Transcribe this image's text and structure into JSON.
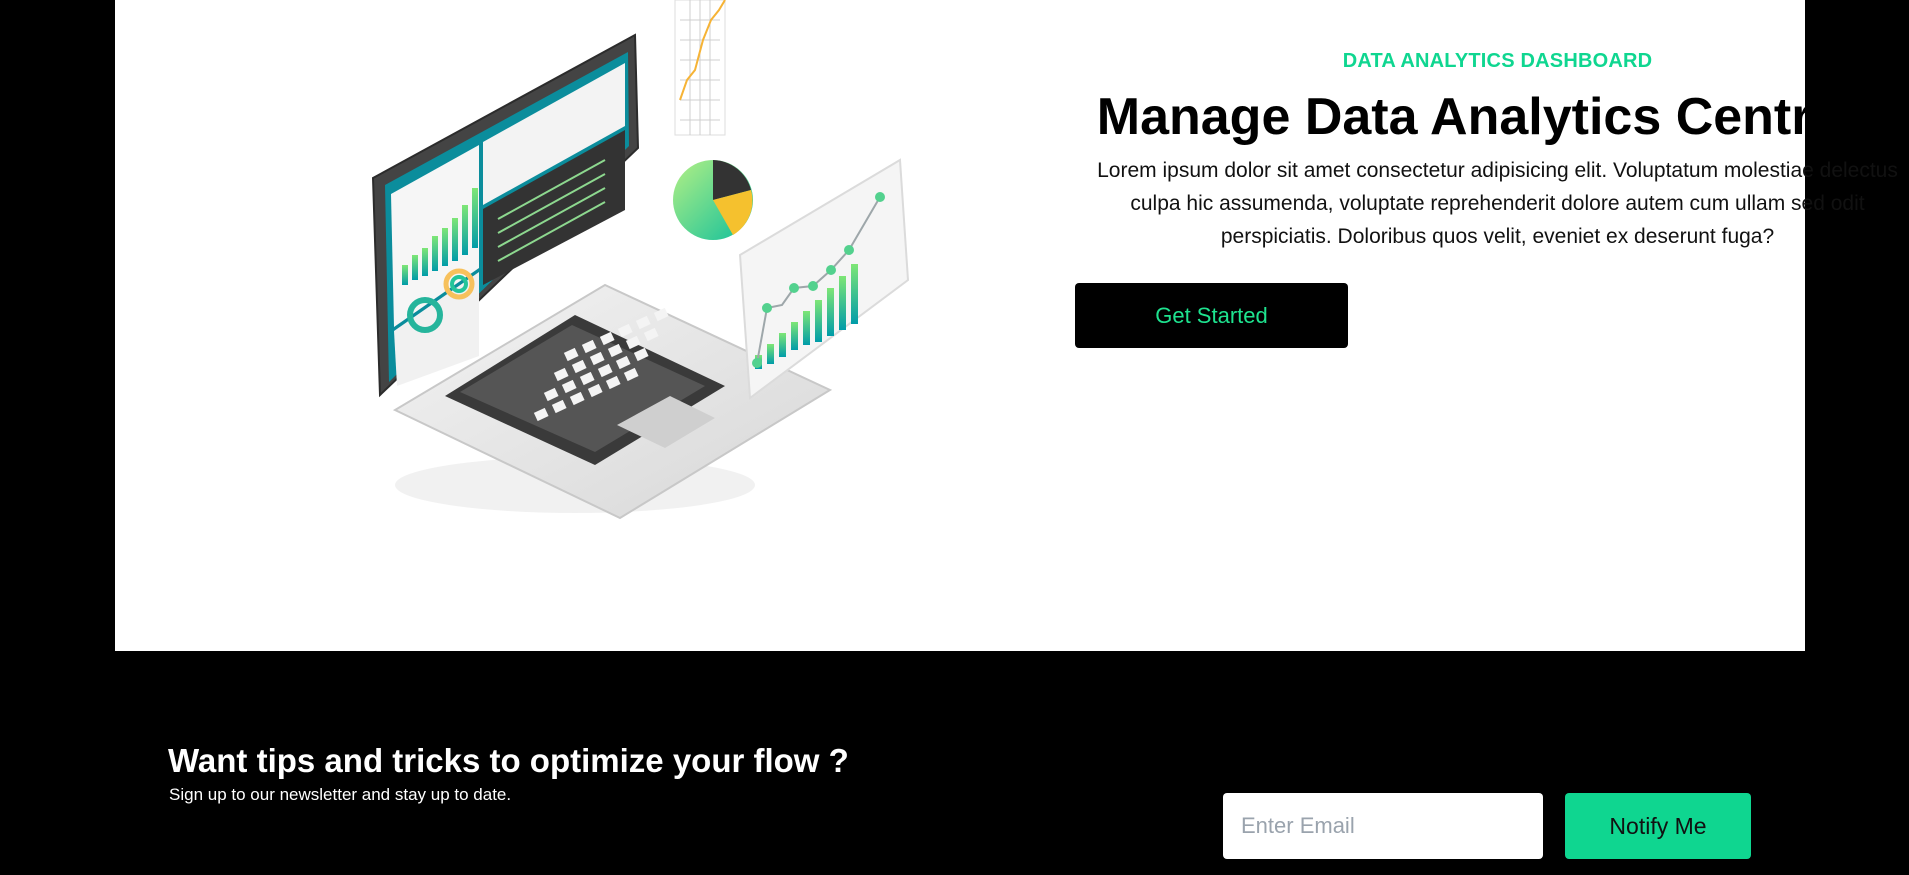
{
  "hero": {
    "eyebrow": "DATA ANALYTICS DASHBOARD",
    "title": "Manage Data Analytics Centrally",
    "body": "Lorem ipsum dolor sit amet consectetur adipisicing elit. Voluptatum molestiae delectus culpa hic assumenda, voluptate reprehenderit dolore autem cum ullam sed odit perspiciatis. Doloribus quos velit, eveniet ex deserunt fuga?",
    "cta_label": "Get Started"
  },
  "newsletter": {
    "title": "Want tips and tricks to optimize your flow ?",
    "subtitle": "Sign up to our newsletter and stay up to date.",
    "email_placeholder": "Enter Email",
    "button_label": "Notify Me"
  },
  "colors": {
    "accent": "#0fd690",
    "background": "#000000",
    "hero_bg": "#ffffff"
  },
  "icons": {
    "illustration": "laptop-analytics-illustration"
  }
}
